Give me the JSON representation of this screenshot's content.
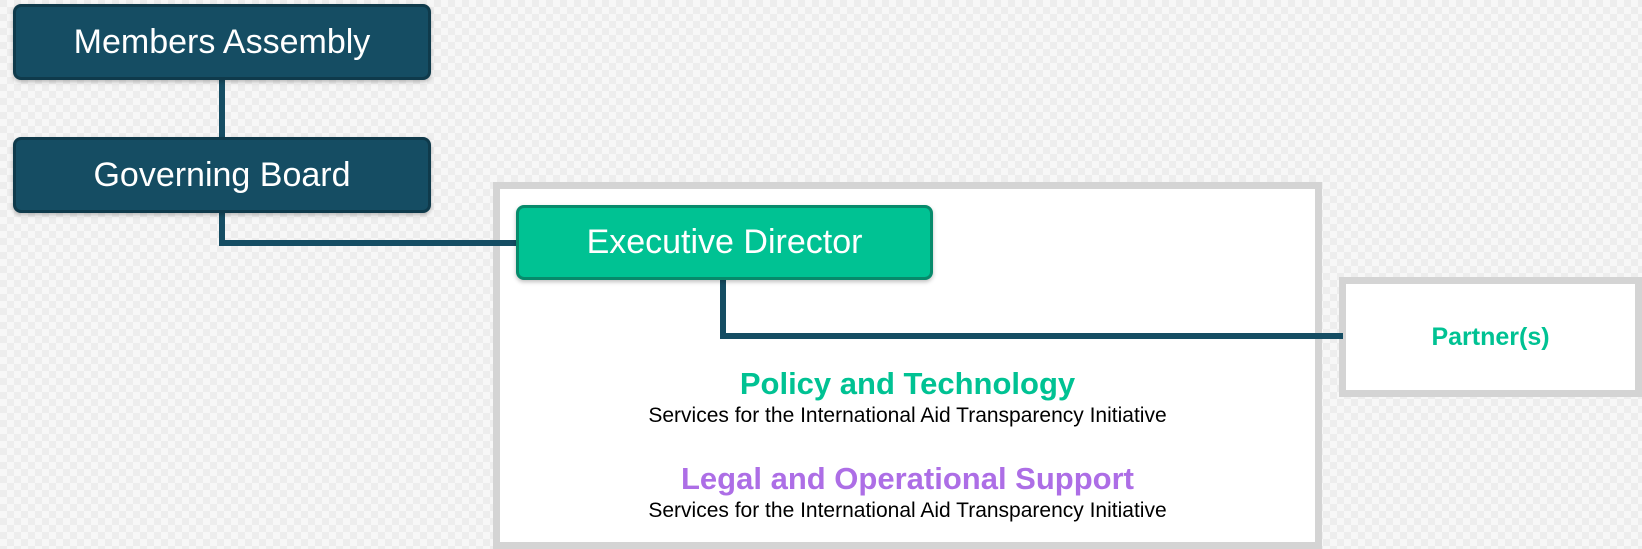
{
  "nodes": {
    "members_assembly": "Members Assembly",
    "governing_board": "Governing Board",
    "executive_director": "Executive Director",
    "partner": "Partner(s)"
  },
  "services": [
    {
      "title": "Policy and Technology",
      "subtitle": "Services for the International Aid Transparency Initiative",
      "color": "#00c293"
    },
    {
      "title": "Legal and Operational Support",
      "subtitle": "Services for the International Aid Transparency Initiative",
      "color": "#ad6ee6"
    }
  ],
  "colors": {
    "governance_node": "#154d63",
    "executive_node": "#00c293",
    "connector": "#154d63",
    "panel_border": "#d4d4d4"
  }
}
